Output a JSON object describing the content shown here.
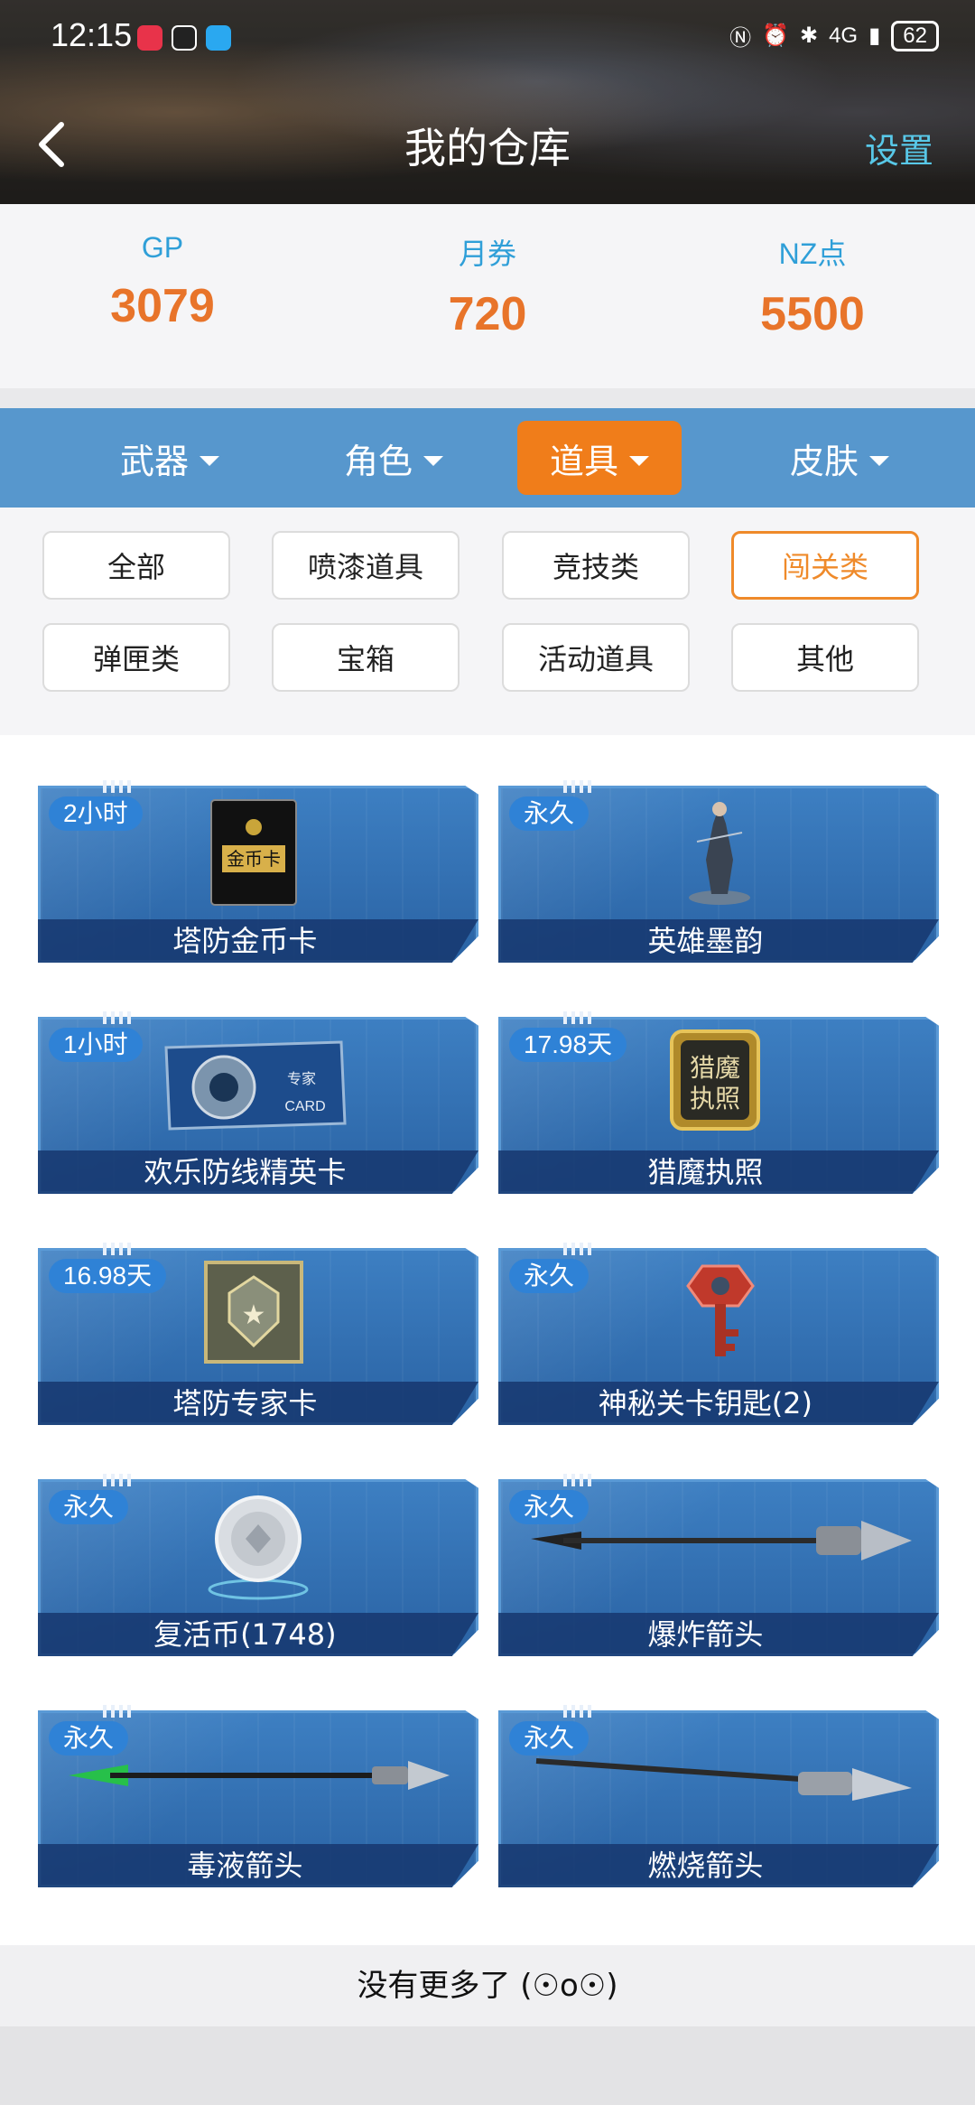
{
  "status_bar": {
    "time": "12:15",
    "battery": "62",
    "network": "4G"
  },
  "nav": {
    "title": "我的仓库",
    "settings_label": "设置"
  },
  "currencies": [
    {
      "label": "GP",
      "value": "3079"
    },
    {
      "label": "月券",
      "value": "720"
    },
    {
      "label": "NZ点",
      "value": "5500"
    }
  ],
  "tabs": [
    {
      "label": "武器",
      "active": false
    },
    {
      "label": "角色",
      "active": false
    },
    {
      "label": "道具",
      "active": true
    },
    {
      "label": "皮肤",
      "active": false
    }
  ],
  "subcategories": [
    {
      "label": "全部",
      "active": false
    },
    {
      "label": "喷漆道具",
      "active": false
    },
    {
      "label": "竞技类",
      "active": false
    },
    {
      "label": "闯关类",
      "active": true
    },
    {
      "label": "弹匣类",
      "active": false
    },
    {
      "label": "宝箱",
      "active": false
    },
    {
      "label": "活动道具",
      "active": false
    },
    {
      "label": "其他",
      "active": false
    }
  ],
  "items": [
    {
      "name": "塔防金币卡",
      "badge": "2小时",
      "icon": "gold-card-icon"
    },
    {
      "name": "英雄墨韵",
      "badge": "永久",
      "icon": "hero-figure-icon"
    },
    {
      "name": "欢乐防线精英卡",
      "badge": "1小时",
      "icon": "expert-card-icon"
    },
    {
      "name": "猎魔执照",
      "badge": "17.98天",
      "icon": "hunter-license-icon"
    },
    {
      "name": "塔防专家卡",
      "badge": "16.98天",
      "icon": "expert-badge-icon"
    },
    {
      "name": "神秘关卡钥匙(2)",
      "badge": "永久",
      "icon": "key-icon"
    },
    {
      "name": "复活币(1748)",
      "badge": "永久",
      "icon": "revive-coin-icon"
    },
    {
      "name": "爆炸箭头",
      "badge": "永久",
      "icon": "explosive-arrow-icon"
    },
    {
      "name": "毒液箭头",
      "badge": "永久",
      "icon": "venom-arrow-icon"
    },
    {
      "name": "燃烧箭头",
      "badge": "永久",
      "icon": "fire-arrow-icon"
    }
  ],
  "footer": {
    "text": "没有更多了 (☉o☉)"
  },
  "colors": {
    "accent_orange": "#f07d1a",
    "tab_blue": "#5797cd",
    "label_blue": "#2f9fd8",
    "value_orange": "#e8742a"
  }
}
